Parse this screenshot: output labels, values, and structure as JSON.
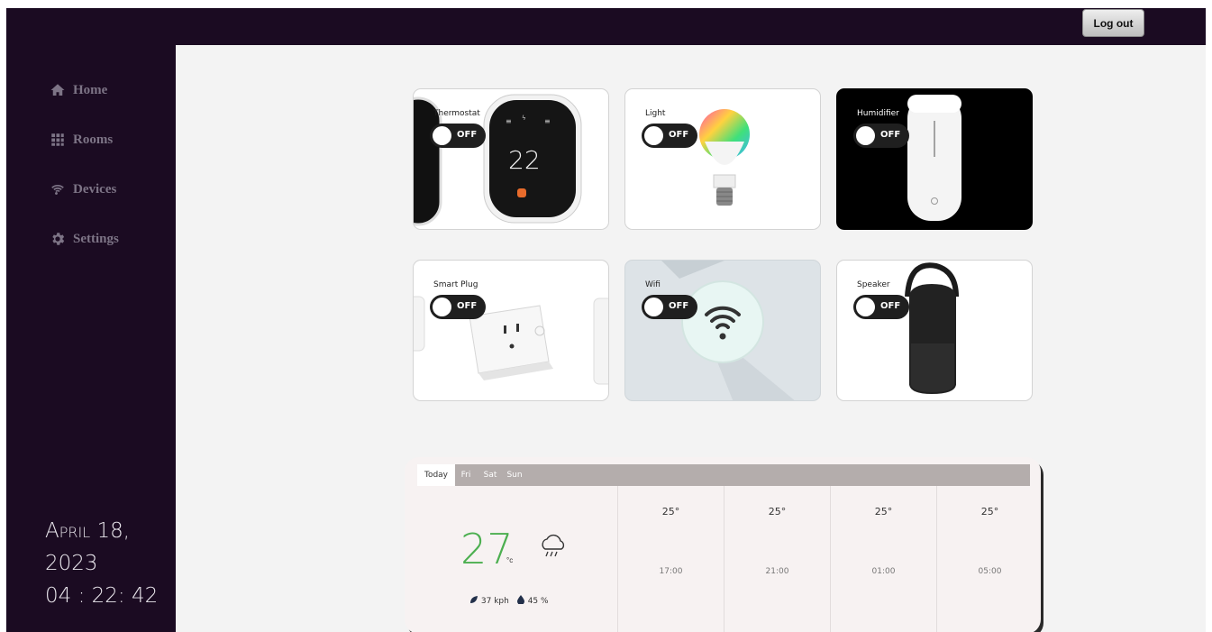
{
  "header": {
    "logout_label": "Log out"
  },
  "sidebar": {
    "items": [
      {
        "label": "Home",
        "icon": "home-icon"
      },
      {
        "label": "Rooms",
        "icon": "grid-icon"
      },
      {
        "label": "Devices",
        "icon": "wifi-icon"
      },
      {
        "label": "Settings",
        "icon": "gear-icon"
      }
    ],
    "date_month_day": "April 18,",
    "date_year": "2023",
    "time": "04 : 22: 42"
  },
  "devices": [
    {
      "label": "Thermostat",
      "state": "OFF",
      "display_value": "22"
    },
    {
      "label": "Light",
      "state": "OFF"
    },
    {
      "label": "Humidifier",
      "state": "OFF"
    },
    {
      "label": "Smart Plug",
      "state": "OFF"
    },
    {
      "label": "Wifi",
      "state": "OFF"
    },
    {
      "label": "Speaker",
      "state": "OFF"
    }
  ],
  "weather": {
    "tabs": [
      "Today",
      "Fri",
      "Sat",
      "Sun"
    ],
    "active_tab": "Today",
    "current_temp": "27",
    "unit": "°c",
    "wind": "37 kph",
    "humidity": "45 %",
    "forecast": [
      {
        "temp": "25°",
        "time": "17:00"
      },
      {
        "temp": "25°",
        "time": "21:00"
      },
      {
        "temp": "25°",
        "time": "01:00"
      },
      {
        "temp": "25°",
        "time": "05:00"
      }
    ]
  },
  "colors": {
    "sidebar_bg": "#1b0b22",
    "content_bg": "#f3f3f3",
    "temp_green": "#4caf50",
    "toggle_bg": "#1f1f1f"
  }
}
